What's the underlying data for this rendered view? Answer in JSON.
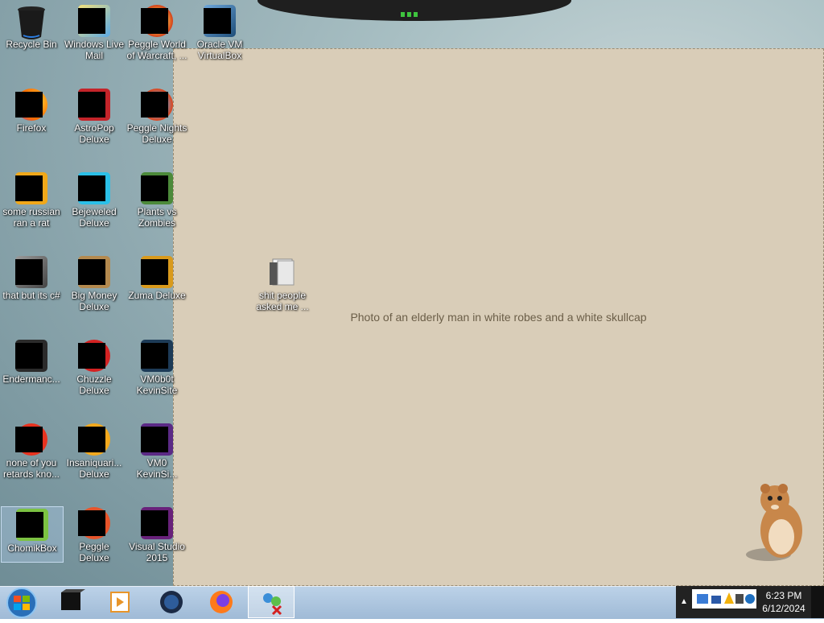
{
  "desktop_icons": [
    {
      "label": "Recycle Bin"
    },
    {
      "label": "Windows Live Mail"
    },
    {
      "label": "Peggle World of Warcraft, ..."
    },
    {
      "label": "Oracle VM VirtualBox"
    },
    {
      "label": "Firefox"
    },
    {
      "label": "AstroPop Deluxe"
    },
    {
      "label": "Peggle Nights Deluxe"
    },
    {
      "label": "some russian ran a rat"
    },
    {
      "label": "Bejeweled Deluxe"
    },
    {
      "label": "Plants vs Zombies"
    },
    {
      "label": "that but its c#"
    },
    {
      "label": "Big Money Deluxe"
    },
    {
      "label": "Zuma Deluxe"
    },
    {
      "label": "shit people asked me ..."
    },
    {
      "label": "Endermanc..."
    },
    {
      "label": "Chuzzle Deluxe"
    },
    {
      "label": "VM0b0t KevinSite"
    },
    {
      "label": "none of you retards kno..."
    },
    {
      "label": "Insaniquari... Deluxe"
    },
    {
      "label": "VM0 KevinSi..."
    },
    {
      "label": "ChomikBox"
    },
    {
      "label": "Peggle Deluxe"
    },
    {
      "label": "Visual Studio 2015"
    }
  ],
  "wallpaper": {
    "label": "Photo of an elderly man in white robes and a white skullcap"
  },
  "taskbar": {
    "items": [
      {
        "icon": "virtualbox-icon"
      },
      {
        "icon": "media-player-icon"
      },
      {
        "icon": "globe-icon"
      },
      {
        "icon": "firefox-icon"
      },
      {
        "icon": "network-app-icon",
        "active": true
      }
    ]
  },
  "clock": {
    "time": "6:23 PM",
    "date": "6/12/2024"
  },
  "colors": {
    "taskbar": "#a9c3de",
    "tray": "#222222",
    "accent": "#3ec43e"
  }
}
